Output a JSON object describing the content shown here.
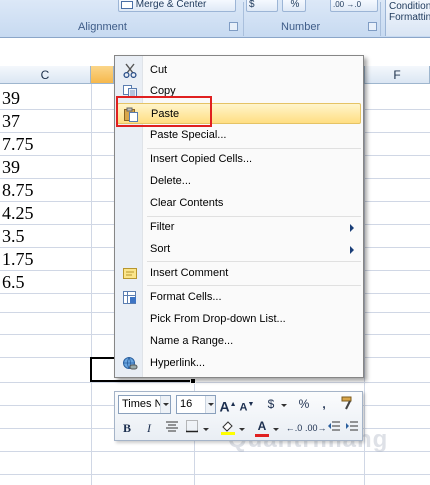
{
  "ribbon": {
    "merge_center": "Merge & Center",
    "currency_symbol": "$",
    "percent_symbol": "%",
    "decimals": ".00 →.0",
    "conditional_formatting": "Conditional Formatting",
    "groups": {
      "alignment": "Alignment",
      "number": "Number"
    }
  },
  "sheet": {
    "columns": {
      "c": "C",
      "d": "",
      "f": "F"
    },
    "cells": [
      "39",
      "37",
      "7.75",
      "39",
      "8.75",
      "4.25",
      "3.5",
      "1.75",
      "6.5"
    ]
  },
  "context_menu": {
    "items": [
      {
        "label": "Cut",
        "icon": "scissors-icon"
      },
      {
        "label": "Copy",
        "icon": "copy-icon"
      },
      {
        "label": "Paste",
        "icon": "paste-icon"
      },
      {
        "label": "Paste Special...",
        "icon": ""
      },
      {
        "label": "Insert Copied Cells...",
        "icon": ""
      },
      {
        "label": "Delete...",
        "icon": ""
      },
      {
        "label": "Clear Contents",
        "icon": ""
      },
      {
        "label": "Filter",
        "icon": "",
        "submenu": true
      },
      {
        "label": "Sort",
        "icon": "",
        "submenu": true
      },
      {
        "label": "Insert Comment",
        "icon": "comment-icon"
      },
      {
        "label": "Format Cells...",
        "icon": "format-cells-icon"
      },
      {
        "label": "Pick From Drop-down List...",
        "icon": ""
      },
      {
        "label": "Name a Range...",
        "icon": ""
      },
      {
        "label": "Hyperlink...",
        "icon": "hyperlink-icon"
      }
    ]
  },
  "mini_toolbar": {
    "font_name": "Times Ne",
    "font_size": "16",
    "grow_font": "A",
    "shrink_font": "A",
    "currency": "$",
    "percent": "%",
    "comma": ",",
    "bold": "B",
    "italic": "I",
    "font_color_letter": "A"
  },
  "watermark": "Quantrimang",
  "colors": {
    "highlight_border": "#e02020",
    "menu_hover": "#ffde82",
    "selected_header": "#f6b84c"
  }
}
